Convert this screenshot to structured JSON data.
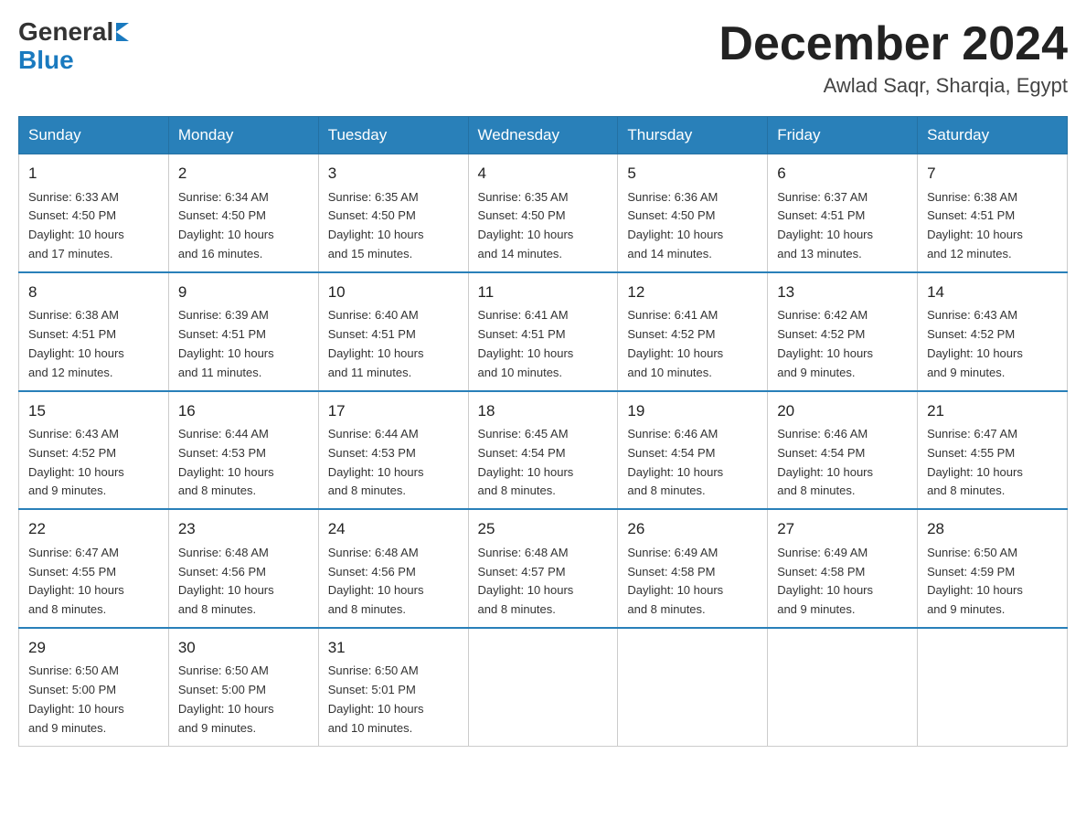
{
  "header": {
    "logo_general": "General",
    "logo_blue": "Blue",
    "month_title": "December 2024",
    "location": "Awlad Saqr, Sharqia, Egypt"
  },
  "days_of_week": [
    "Sunday",
    "Monday",
    "Tuesday",
    "Wednesday",
    "Thursday",
    "Friday",
    "Saturday"
  ],
  "weeks": [
    [
      {
        "date": "1",
        "sunrise": "6:33 AM",
        "sunset": "4:50 PM",
        "daylight": "10 hours and 17 minutes."
      },
      {
        "date": "2",
        "sunrise": "6:34 AM",
        "sunset": "4:50 PM",
        "daylight": "10 hours and 16 minutes."
      },
      {
        "date": "3",
        "sunrise": "6:35 AM",
        "sunset": "4:50 PM",
        "daylight": "10 hours and 15 minutes."
      },
      {
        "date": "4",
        "sunrise": "6:35 AM",
        "sunset": "4:50 PM",
        "daylight": "10 hours and 14 minutes."
      },
      {
        "date": "5",
        "sunrise": "6:36 AM",
        "sunset": "4:50 PM",
        "daylight": "10 hours and 14 minutes."
      },
      {
        "date": "6",
        "sunrise": "6:37 AM",
        "sunset": "4:51 PM",
        "daylight": "10 hours and 13 minutes."
      },
      {
        "date": "7",
        "sunrise": "6:38 AM",
        "sunset": "4:51 PM",
        "daylight": "10 hours and 12 minutes."
      }
    ],
    [
      {
        "date": "8",
        "sunrise": "6:38 AM",
        "sunset": "4:51 PM",
        "daylight": "10 hours and 12 minutes."
      },
      {
        "date": "9",
        "sunrise": "6:39 AM",
        "sunset": "4:51 PM",
        "daylight": "10 hours and 11 minutes."
      },
      {
        "date": "10",
        "sunrise": "6:40 AM",
        "sunset": "4:51 PM",
        "daylight": "10 hours and 11 minutes."
      },
      {
        "date": "11",
        "sunrise": "6:41 AM",
        "sunset": "4:51 PM",
        "daylight": "10 hours and 10 minutes."
      },
      {
        "date": "12",
        "sunrise": "6:41 AM",
        "sunset": "4:52 PM",
        "daylight": "10 hours and 10 minutes."
      },
      {
        "date": "13",
        "sunrise": "6:42 AM",
        "sunset": "4:52 PM",
        "daylight": "10 hours and 9 minutes."
      },
      {
        "date": "14",
        "sunrise": "6:43 AM",
        "sunset": "4:52 PM",
        "daylight": "10 hours and 9 minutes."
      }
    ],
    [
      {
        "date": "15",
        "sunrise": "6:43 AM",
        "sunset": "4:52 PM",
        "daylight": "10 hours and 9 minutes."
      },
      {
        "date": "16",
        "sunrise": "6:44 AM",
        "sunset": "4:53 PM",
        "daylight": "10 hours and 8 minutes."
      },
      {
        "date": "17",
        "sunrise": "6:44 AM",
        "sunset": "4:53 PM",
        "daylight": "10 hours and 8 minutes."
      },
      {
        "date": "18",
        "sunrise": "6:45 AM",
        "sunset": "4:54 PM",
        "daylight": "10 hours and 8 minutes."
      },
      {
        "date": "19",
        "sunrise": "6:46 AM",
        "sunset": "4:54 PM",
        "daylight": "10 hours and 8 minutes."
      },
      {
        "date": "20",
        "sunrise": "6:46 AM",
        "sunset": "4:54 PM",
        "daylight": "10 hours and 8 minutes."
      },
      {
        "date": "21",
        "sunrise": "6:47 AM",
        "sunset": "4:55 PM",
        "daylight": "10 hours and 8 minutes."
      }
    ],
    [
      {
        "date": "22",
        "sunrise": "6:47 AM",
        "sunset": "4:55 PM",
        "daylight": "10 hours and 8 minutes."
      },
      {
        "date": "23",
        "sunrise": "6:48 AM",
        "sunset": "4:56 PM",
        "daylight": "10 hours and 8 minutes."
      },
      {
        "date": "24",
        "sunrise": "6:48 AM",
        "sunset": "4:56 PM",
        "daylight": "10 hours and 8 minutes."
      },
      {
        "date": "25",
        "sunrise": "6:48 AM",
        "sunset": "4:57 PM",
        "daylight": "10 hours and 8 minutes."
      },
      {
        "date": "26",
        "sunrise": "6:49 AM",
        "sunset": "4:58 PM",
        "daylight": "10 hours and 8 minutes."
      },
      {
        "date": "27",
        "sunrise": "6:49 AM",
        "sunset": "4:58 PM",
        "daylight": "10 hours and 9 minutes."
      },
      {
        "date": "28",
        "sunrise": "6:50 AM",
        "sunset": "4:59 PM",
        "daylight": "10 hours and 9 minutes."
      }
    ],
    [
      {
        "date": "29",
        "sunrise": "6:50 AM",
        "sunset": "5:00 PM",
        "daylight": "10 hours and 9 minutes."
      },
      {
        "date": "30",
        "sunrise": "6:50 AM",
        "sunset": "5:00 PM",
        "daylight": "10 hours and 9 minutes."
      },
      {
        "date": "31",
        "sunrise": "6:50 AM",
        "sunset": "5:01 PM",
        "daylight": "10 hours and 10 minutes."
      },
      null,
      null,
      null,
      null
    ]
  ],
  "labels": {
    "sunrise": "Sunrise:",
    "sunset": "Sunset:",
    "daylight": "Daylight:"
  }
}
